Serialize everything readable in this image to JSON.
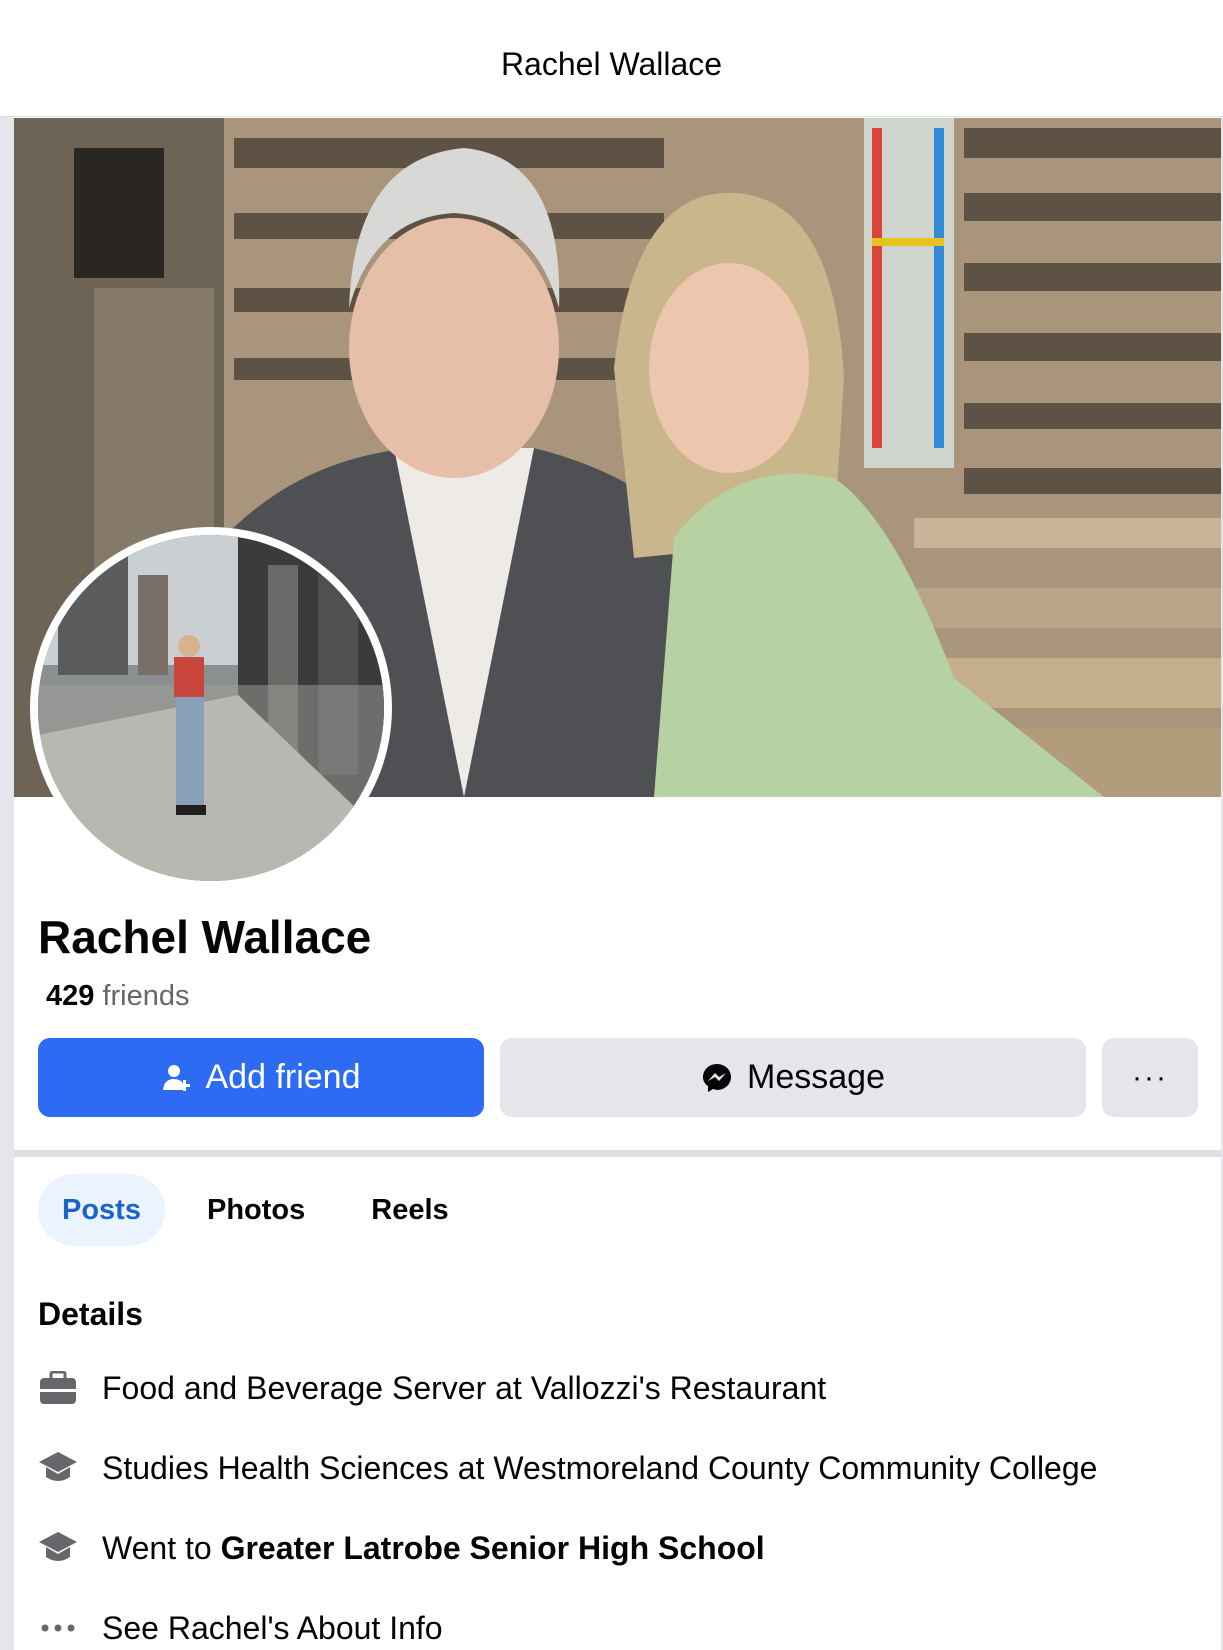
{
  "header": {
    "title": "Rachel Wallace"
  },
  "profile": {
    "name": "Rachel Wallace",
    "friends_count": "429",
    "friends_label": "friends"
  },
  "actions": {
    "add_friend": "Add friend",
    "message": "Message",
    "more": "···"
  },
  "tabs": [
    {
      "label": "Posts",
      "active": true
    },
    {
      "label": "Photos",
      "active": false
    },
    {
      "label": "Reels",
      "active": false
    }
  ],
  "details": {
    "title": "Details",
    "items": [
      {
        "icon": "briefcase-icon",
        "text": "Food and Beverage Server at Vallozzi's Restaurant"
      },
      {
        "icon": "graduation-cap-icon",
        "text": "Studies Health Sciences at Westmoreland County Community College"
      },
      {
        "icon": "graduation-cap-icon",
        "prefix": "Went to ",
        "bold": "Greater Latrobe Senior High School"
      },
      {
        "icon": "more-dots-icon",
        "text": "See Rachel's About Info"
      }
    ]
  },
  "colors": {
    "primary": "#2d6bf2",
    "secondary_button": "#e4e6eb",
    "active_tab_bg": "#ebf3ff",
    "active_tab_text": "#1a64c9"
  }
}
